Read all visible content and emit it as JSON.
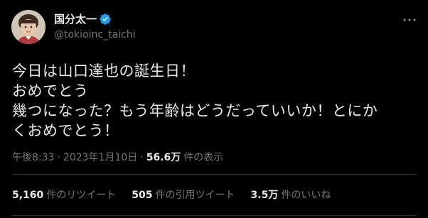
{
  "tweet": {
    "display_name": "国分太一",
    "handle": "@tokioinc_taichi",
    "text": "今日は山口達也の誕生日！\nおめでとう\n幾つになった？もう年齢はどうだっていいか！とにか\nくおめでとう！",
    "time": "午後8:33",
    "separator": "·",
    "date": "2023年1月10日",
    "separator2": "·",
    "views_count": "56.6万",
    "views_label": "件の表示"
  },
  "stats": {
    "retweets_count": "5,160",
    "retweets_label": "件のリツイート",
    "quotes_count": "505",
    "quotes_label": "件の引用ツイート",
    "likes_count": "3.5万",
    "likes_label": "件のいいね"
  },
  "icons": {
    "verified": "verified-badge-icon",
    "more": "more-horizontal-icon"
  },
  "colors": {
    "background": "#000000",
    "text_primary": "#e7e9ea",
    "text_secondary": "#71767b",
    "divider": "#2f3336",
    "verified_blue": "#1d9bf0"
  }
}
